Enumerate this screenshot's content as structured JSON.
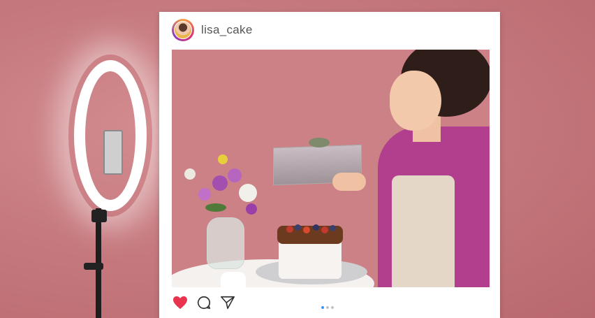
{
  "post": {
    "username": "lisa_cake"
  },
  "icons": {
    "like": "heart-icon",
    "comment": "comment-icon",
    "share": "paper-plane-icon",
    "like_color": "#e8344e"
  },
  "carousel": {
    "count": 3,
    "active_index": 0
  },
  "colors": {
    "background": "#c67a7f",
    "accent": "#3897f0"
  }
}
